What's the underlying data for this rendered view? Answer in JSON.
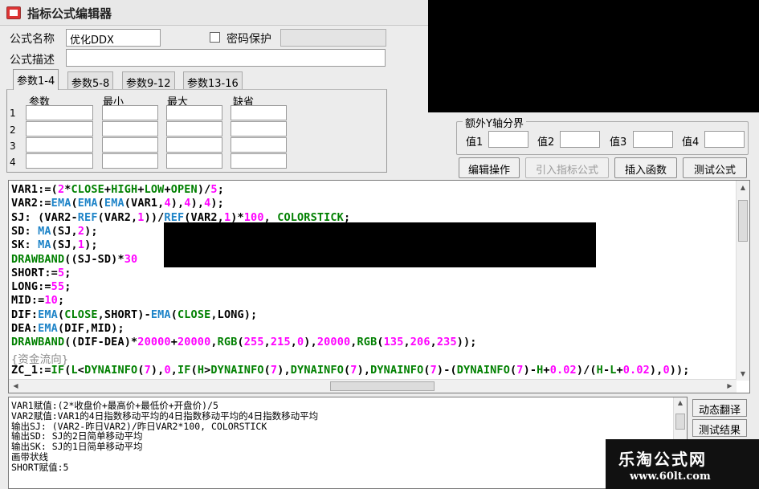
{
  "window": {
    "title": "指标公式编辑器"
  },
  "form": {
    "name_label": "公式名称",
    "name_value": "优化DDX",
    "password_label": "密码保护",
    "password_value": "",
    "desc_label": "公式描述",
    "desc_value": ""
  },
  "tabs": [
    {
      "label": "参数1-4"
    },
    {
      "label": "参数5-8"
    },
    {
      "label": "参数9-12"
    },
    {
      "label": "参数13-16"
    }
  ],
  "params": {
    "headers": [
      "参数",
      "最小",
      "最大",
      "缺省"
    ],
    "rows": [
      "1",
      "2",
      "3",
      "4"
    ]
  },
  "yaxis": {
    "title": "额外Y轴分界",
    "labels": [
      "值1",
      "值2",
      "值3",
      "值4"
    ]
  },
  "buttons": {
    "edit": "编辑操作",
    "import": "引入指标公式",
    "insert_func": "插入函数",
    "test": "测试公式",
    "dynamic_translate": "动态翻译",
    "test_result": "测试结果"
  },
  "code_lines": [
    [
      [
        "t",
        "VAR1:=("
      ],
      [
        "n",
        "2"
      ],
      [
        "t",
        "*"
      ],
      [
        "k",
        "CLOSE"
      ],
      [
        "t",
        "+"
      ],
      [
        "k",
        "HIGH"
      ],
      [
        "t",
        "+"
      ],
      [
        "k",
        "LOW"
      ],
      [
        "t",
        "+"
      ],
      [
        "k",
        "OPEN"
      ],
      [
        "t",
        ")/"
      ],
      [
        "n",
        "5"
      ],
      [
        "t",
        ";"
      ]
    ],
    [
      [
        "t",
        "VAR2:="
      ],
      [
        "f",
        "EMA"
      ],
      [
        "t",
        "("
      ],
      [
        "f",
        "EMA"
      ],
      [
        "t",
        "("
      ],
      [
        "f",
        "EMA"
      ],
      [
        "t",
        "(VAR1,"
      ],
      [
        "n",
        "4"
      ],
      [
        "t",
        "),"
      ],
      [
        "n",
        "4"
      ],
      [
        "t",
        "),"
      ],
      [
        "n",
        "4"
      ],
      [
        "t",
        ");"
      ]
    ],
    [
      [
        "t",
        "SJ: (VAR2-"
      ],
      [
        "f",
        "REF"
      ],
      [
        "t",
        "(VAR2,"
      ],
      [
        "n",
        "1"
      ],
      [
        "t",
        "))/"
      ],
      [
        "f",
        "REF"
      ],
      [
        "t",
        "(VAR2,"
      ],
      [
        "n",
        "1"
      ],
      [
        "t",
        ")*"
      ],
      [
        "n",
        "100"
      ],
      [
        "t",
        ", "
      ],
      [
        "k",
        "COLORSTICK"
      ],
      [
        "t",
        ";"
      ]
    ],
    [
      [
        "t",
        "SD: "
      ],
      [
        "f",
        "MA"
      ],
      [
        "t",
        "(SJ,"
      ],
      [
        "n",
        "2"
      ],
      [
        "t",
        ");"
      ]
    ],
    [
      [
        "t",
        "SK: "
      ],
      [
        "f",
        "MA"
      ],
      [
        "t",
        "(SJ,"
      ],
      [
        "n",
        "1"
      ],
      [
        "t",
        ");"
      ]
    ],
    [
      [
        "k",
        "DRAWBAND"
      ],
      [
        "t",
        "((SJ-SD)*"
      ],
      [
        "n",
        "30"
      ]
    ],
    [
      [
        "t",
        "SHORT:="
      ],
      [
        "n",
        "5"
      ],
      [
        "t",
        ";"
      ]
    ],
    [
      [
        "t",
        "LONG:="
      ],
      [
        "n",
        "55"
      ],
      [
        "t",
        ";"
      ]
    ],
    [
      [
        "t",
        "MID:="
      ],
      [
        "n",
        "10"
      ],
      [
        "t",
        ";"
      ]
    ],
    [
      [
        "t",
        "DIF:"
      ],
      [
        "f",
        "EMA"
      ],
      [
        "t",
        "("
      ],
      [
        "k",
        "CLOSE"
      ],
      [
        "t",
        ",SHORT)-"
      ],
      [
        "f",
        "EMA"
      ],
      [
        "t",
        "("
      ],
      [
        "k",
        "CLOSE"
      ],
      [
        "t",
        ",LONG);"
      ]
    ],
    [
      [
        "t",
        "DEA:"
      ],
      [
        "f",
        "EMA"
      ],
      [
        "t",
        "(DIF,MID);"
      ]
    ],
    [
      [
        "k",
        "DRAWBAND"
      ],
      [
        "t",
        "((DIF-DEA)*"
      ],
      [
        "n",
        "20000"
      ],
      [
        "t",
        "+"
      ],
      [
        "n",
        "20000"
      ],
      [
        "t",
        ","
      ],
      [
        "k",
        "RGB"
      ],
      [
        "t",
        "("
      ],
      [
        "n",
        "255"
      ],
      [
        "t",
        ","
      ],
      [
        "n",
        "215"
      ],
      [
        "t",
        ","
      ],
      [
        "n",
        "0"
      ],
      [
        "t",
        "),"
      ],
      [
        "n",
        "20000"
      ],
      [
        "t",
        ","
      ],
      [
        "k",
        "RGB"
      ],
      [
        "t",
        "("
      ],
      [
        "n",
        "135"
      ],
      [
        "t",
        ","
      ],
      [
        "n",
        "206"
      ],
      [
        "t",
        ","
      ],
      [
        "n",
        "235"
      ],
      [
        "t",
        "));"
      ]
    ],
    [
      [
        "c",
        "{资金流向}"
      ]
    ],
    [
      [
        "t",
        "ZC_1:="
      ],
      [
        "k",
        "IF"
      ],
      [
        "t",
        "("
      ],
      [
        "k",
        "L"
      ],
      [
        "t",
        "<"
      ],
      [
        "k",
        "DYNAINFO"
      ],
      [
        "t",
        "("
      ],
      [
        "n",
        "7"
      ],
      [
        "t",
        "),"
      ],
      [
        "n",
        "0"
      ],
      [
        "t",
        ","
      ],
      [
        "k",
        "IF"
      ],
      [
        "t",
        "("
      ],
      [
        "k",
        "H"
      ],
      [
        "t",
        ">"
      ],
      [
        "k",
        "DYNAINFO"
      ],
      [
        "t",
        "("
      ],
      [
        "n",
        "7"
      ],
      [
        "t",
        "),"
      ],
      [
        "k",
        "DYNAINFO"
      ],
      [
        "t",
        "("
      ],
      [
        "n",
        "7"
      ],
      [
        "t",
        "),"
      ],
      [
        "k",
        "DYNAINFO"
      ],
      [
        "t",
        "("
      ],
      [
        "n",
        "7"
      ],
      [
        "t",
        ")-("
      ],
      [
        "k",
        "DYNAINFO"
      ],
      [
        "t",
        "("
      ],
      [
        "n",
        "7"
      ],
      [
        "t",
        ")-"
      ],
      [
        "k",
        "H"
      ],
      [
        "t",
        "+"
      ],
      [
        "n",
        "0.02"
      ],
      [
        "t",
        ")/("
      ],
      [
        "k",
        "H"
      ],
      [
        "t",
        "-"
      ],
      [
        "k",
        "L"
      ],
      [
        "t",
        "+"
      ],
      [
        "n",
        "0.02"
      ],
      [
        "t",
        "),"
      ],
      [
        "n",
        "0"
      ],
      [
        "t",
        "));"
      ]
    ]
  ],
  "translation_lines": [
    "VAR1赋值:(2*收盘价+最高价+最低价+开盘价)/5",
    "VAR2赋值:VAR1的4日指数移动平均的4日指数移动平均的4日指数移动平均",
    "输出SJ: (VAR2-昨日VAR2)/昨日VAR2*100, COLORSTICK",
    "输出SD: SJ的2日简单移动平均",
    "输出SK: SJ的1日简单移动平均",
    "画带状线",
    "SHORT赋值:5"
  ],
  "watermark": {
    "name": "乐淘公式网",
    "url": "www.60lt.com"
  },
  "colors": {
    "keyword": "#008000",
    "function": "#1e84c8",
    "number": "#ff00ff",
    "comment": "#8a8a8a"
  }
}
